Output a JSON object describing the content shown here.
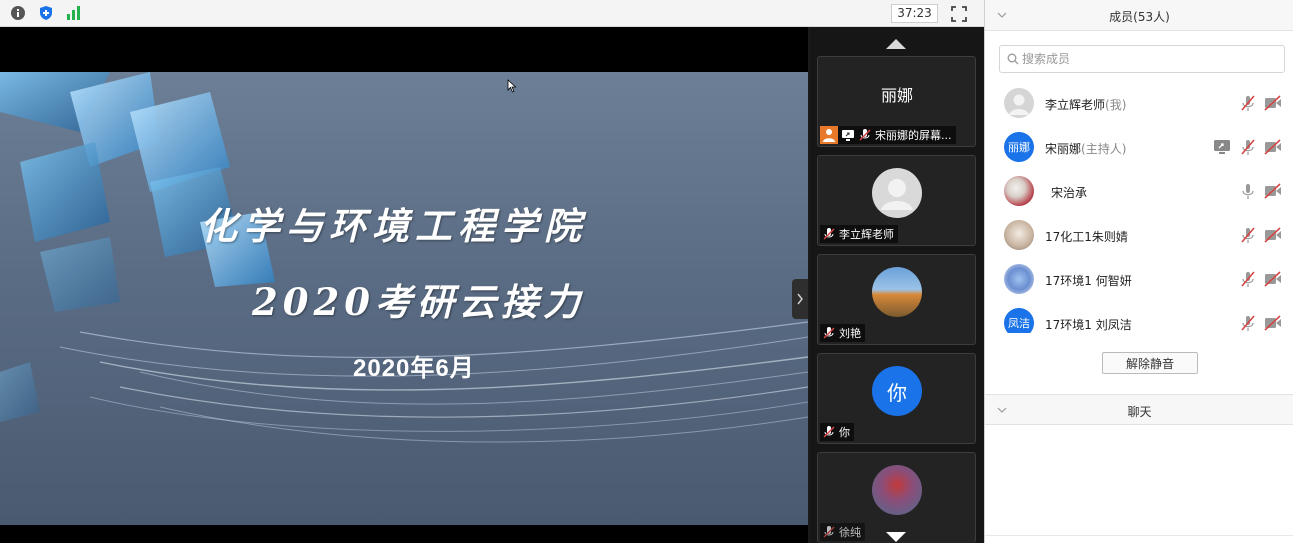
{
  "topbar": {
    "timer": "37:23",
    "icons": [
      "info-icon",
      "shield-icon",
      "signal-icon",
      "fullscreen-icon"
    ]
  },
  "slide": {
    "title": "化学与环境工程学院",
    "subtitle": "2020考研云接力",
    "date": "2020年6月"
  },
  "thumbnails": [
    {
      "avatar_text": "丽娜",
      "avatar_color": "#1a4fa0",
      "label": "宋丽娜的屏幕..."
    },
    {
      "avatar_text": "",
      "avatar_color": "#d9d9d9",
      "label": "李立辉老师"
    },
    {
      "avatar_text": "",
      "avatar_color": "#c7873a",
      "label": "刘艳"
    },
    {
      "avatar_text": "你",
      "avatar_color": "#1a73e8",
      "label": "你"
    },
    {
      "avatar_text": "",
      "avatar_color": "#7a5a80",
      "label": "徐纯"
    }
  ],
  "panel": {
    "members_title": "成员(53人)",
    "search_placeholder": "搜索成员",
    "members": [
      {
        "name": "李立辉老师",
        "tag": "(我)",
        "avatar_text": "",
        "avatar_color": "#d5d5d5"
      },
      {
        "name": "宋丽娜",
        "tag": "(主持人)",
        "avatar_text": "丽娜",
        "avatar_color": "#1a73e8"
      },
      {
        "name": "宋治承",
        "tag": "",
        "avatar_text": "",
        "avatar_color": "#b8454f"
      },
      {
        "name": "17化工1朱则婧",
        "tag": "",
        "avatar_text": "",
        "avatar_color": "#cbb7a4"
      },
      {
        "name": "17环境1 何智妍",
        "tag": "",
        "avatar_text": "",
        "avatar_color": "#6b8fd1"
      },
      {
        "name": "17环境1 刘凤洁",
        "tag": "",
        "avatar_text": "凤洁",
        "avatar_color": "#1a73e8"
      }
    ],
    "unmute_label": "解除静音",
    "chat_title": "聊天"
  },
  "colors": {
    "accent_blue": "#1a73e8",
    "muted_red": "#d64545",
    "signal_green": "#22b14c"
  }
}
